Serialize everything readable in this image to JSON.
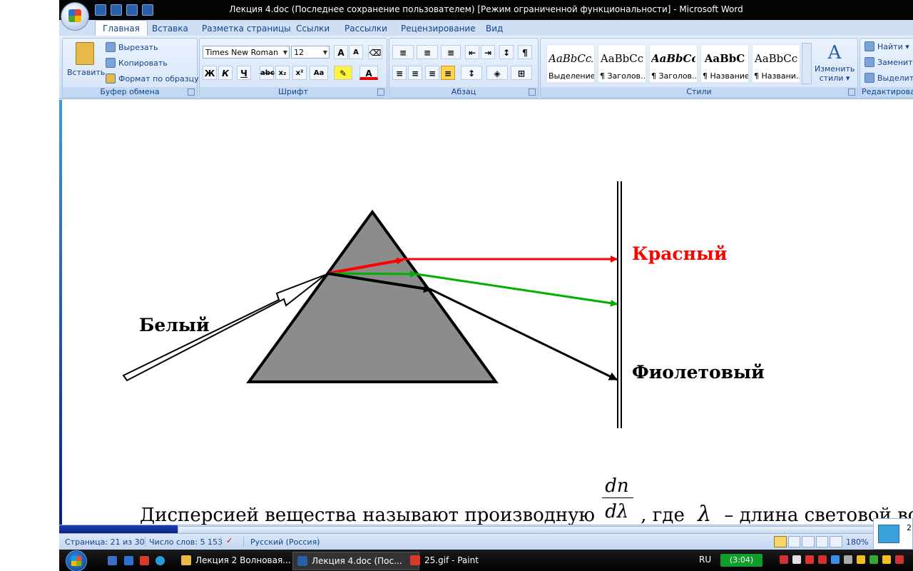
{
  "window": {
    "title": "Лекция 4.doc (Последнее сохранение пользователем) [Режим ограниченной функциональности] - Microsoft Word"
  },
  "ribbon_tabs": [
    "Главная",
    "Вставка",
    "Разметка страницы",
    "Ссылки",
    "Рассылки",
    "Рецензирование",
    "Вид"
  ],
  "clipboard": {
    "paste": "Вставить",
    "cut": "Вырезать",
    "copy": "Копировать",
    "format_painter": "Формат по образцу",
    "label": "Буфер обмена"
  },
  "font": {
    "name": "Times New Roman",
    "size": "12",
    "label": "Шрифт",
    "bold": "Ж",
    "italic": "К",
    "underline": "Ч",
    "strike": "abc",
    "subscript": "x₂",
    "superscript": "x²",
    "case": "Aa",
    "color_letter": "A",
    "grow": "A",
    "shrink": "A"
  },
  "paragraph": {
    "label": "Абзац",
    "pilcrow": "¶"
  },
  "styles": {
    "label": "Стили",
    "items": [
      {
        "sample": "AaBbCcI",
        "name": "Выделение"
      },
      {
        "sample": "AaBbCc",
        "name": "¶ Заголов..."
      },
      {
        "sample": "AaBbCci",
        "name": "¶ Заголов..."
      },
      {
        "sample": "AaBbC",
        "name": "¶ Название"
      },
      {
        "sample": "AaBbCc",
        "name": "¶ Названи..."
      }
    ],
    "change": [
      "Изменить",
      "стили ▾"
    ]
  },
  "editing": {
    "label": "Редактирован",
    "find": "Найти ▾",
    "replace": "Заменит",
    "select": "Выделит"
  },
  "diagram": {
    "label_white": "Белый",
    "label_red": "Красный",
    "label_violet": "Фиолетовый",
    "colors": {
      "prism": "#8c8c8c",
      "red": "#ff0000",
      "green": "#00b000",
      "black": "#000000"
    }
  },
  "document": {
    "line_before": "Дисперсией вещества называют производную",
    "fraction_num": "dn",
    "fraction_den": "dλ",
    "where": ", где",
    "lambda": "λ",
    "line_after": "– длина световой волны в в"
  },
  "statusbar": {
    "page": "Страница: 21 из 30",
    "words": "Число слов: 5 153",
    "language": "Русский (Россия)",
    "zoom": "180%"
  },
  "taskbar": {
    "tasks": [
      "Лекция 2 Волновая...",
      "Лекция 4.doc (Пос...",
      "25.gif - Paint"
    ],
    "lang": "RU",
    "clock": "(3:04)",
    "popup_text": "2"
  }
}
